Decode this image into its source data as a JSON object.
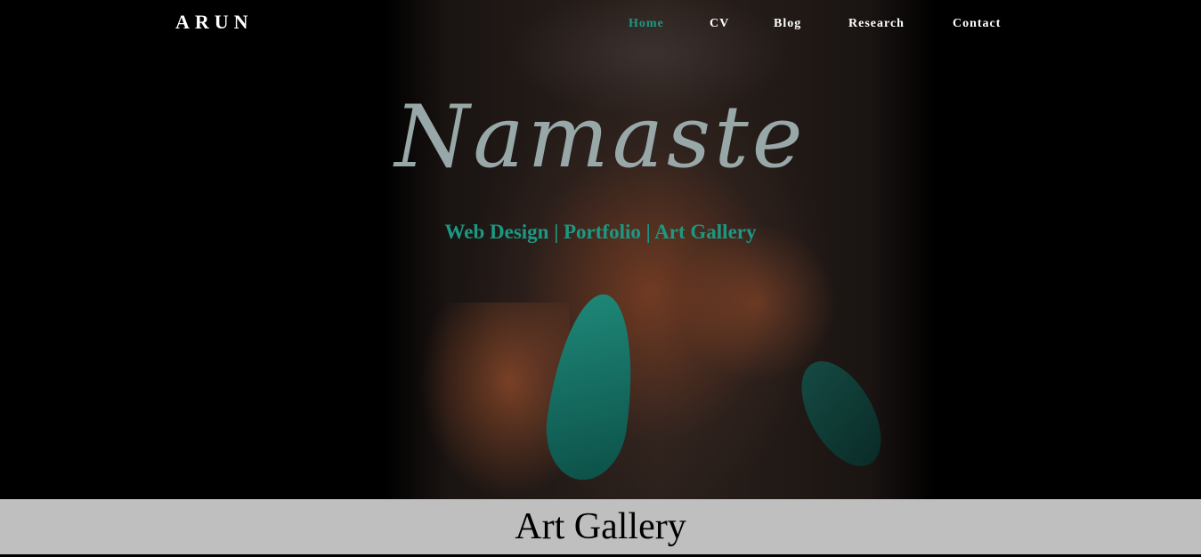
{
  "brand": "ARUN",
  "nav": {
    "items": [
      {
        "label": "Home",
        "active": true
      },
      {
        "label": "CV"
      },
      {
        "label": "Blog"
      },
      {
        "label": "Research"
      },
      {
        "label": "Contact"
      }
    ]
  },
  "hero": {
    "title": "Namaste",
    "subtitle": "Web Design | Portfolio | Art Gallery"
  },
  "section": {
    "title": "Art Gallery"
  },
  "colors": {
    "accent": "#1c9983",
    "title": "#98a8a8",
    "section_bar": "#bfbfbf",
    "background": "#000000"
  }
}
